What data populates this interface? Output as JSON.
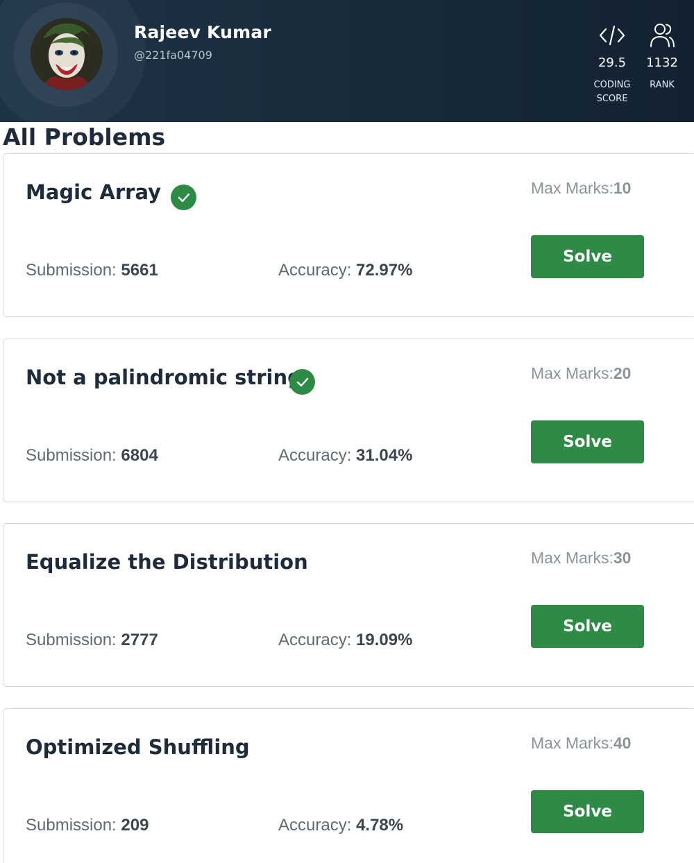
{
  "profile": {
    "name": "Rajeev Kumar",
    "handle": "@221fa04709",
    "avatar_icon": "avatar-icon",
    "stats": [
      {
        "icon": "code-icon",
        "value": "29.5",
        "label_line1": "CODING",
        "label_line2": "SCORE"
      },
      {
        "icon": "users-icon",
        "value": "1132",
        "label_line1": "RANK",
        "label_line2": ""
      }
    ]
  },
  "section_title": "All Problems",
  "labels": {
    "max_marks": "Max Marks:",
    "submission": "Submission:",
    "accuracy": "Accuracy:",
    "solve": "Solve"
  },
  "problems": [
    {
      "title": "Magic Array",
      "solved": true,
      "max_marks": "10",
      "submissions": "5661",
      "accuracy": "72.97%"
    },
    {
      "title": "Not a palindromic string",
      "solved": true,
      "max_marks": "20",
      "submissions": "6804",
      "accuracy": "31.04%"
    },
    {
      "title": "Equalize the Distribution",
      "solved": false,
      "max_marks": "30",
      "submissions": "2777",
      "accuracy": "19.09%"
    },
    {
      "title": "Optimized Shuffling",
      "solved": false,
      "max_marks": "40",
      "submissions": "209",
      "accuracy": "4.78%"
    }
  ],
  "colors": {
    "header_bg": "#1a2c3c",
    "accent_green": "#2e8b45",
    "title_text": "#1d2b3a",
    "muted_text": "#8b949c"
  }
}
